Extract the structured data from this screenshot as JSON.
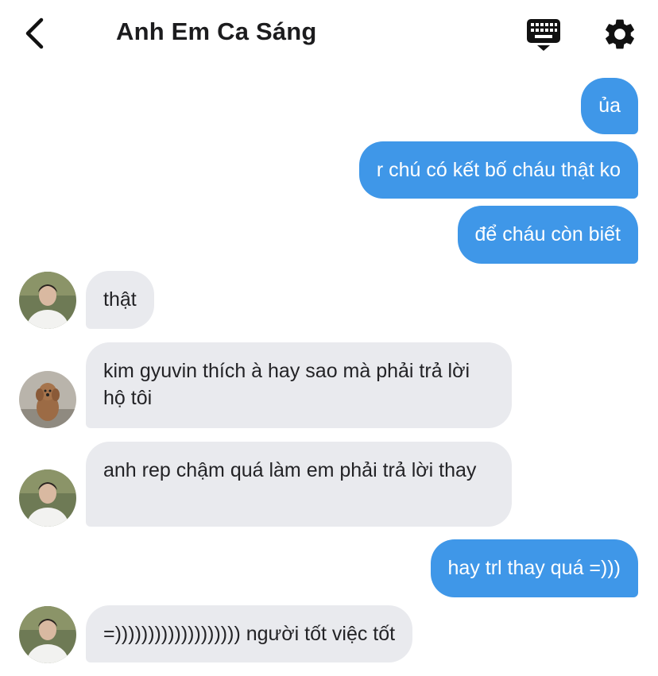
{
  "header": {
    "title": "Anh Em Ca Sáng",
    "back_icon": "chevron-left-icon",
    "keyboard_icon": "keyboard-icon",
    "settings_icon": "gear-icon"
  },
  "colors": {
    "outgoing_bubble": "#3f97e8",
    "incoming_bubble": "#e9eaee",
    "text_dark": "#1c1c1e"
  },
  "messages": [
    {
      "direction": "outgoing",
      "text": "ủa"
    },
    {
      "direction": "outgoing",
      "text": "r chú có kết bố cháu thật ko"
    },
    {
      "direction": "outgoing",
      "text": "để cháu còn biết"
    },
    {
      "direction": "incoming",
      "avatar": "person-avatar",
      "text": "thật"
    },
    {
      "direction": "incoming",
      "avatar": "dog-avatar",
      "text": "kim gyuvin thích à hay sao mà phải trả lời hộ tôi"
    },
    {
      "direction": "incoming",
      "avatar": "person-avatar",
      "text": "anh rep chậm quá làm em phải trả lời thay"
    },
    {
      "direction": "outgoing",
      "text": "hay trl thay quá =)))"
    },
    {
      "direction": "incoming",
      "avatar": "person-avatar",
      "text": "=))))))))))))))))))) người tốt việc tốt"
    }
  ]
}
